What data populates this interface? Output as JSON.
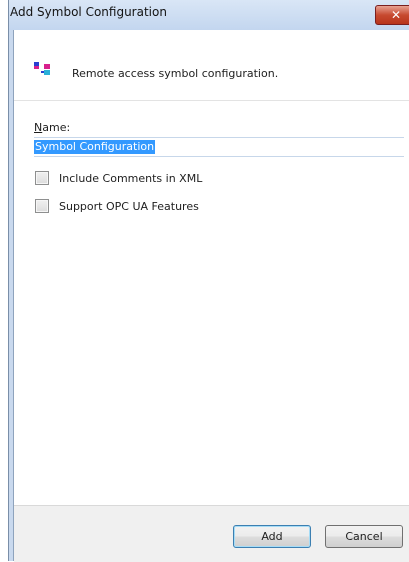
{
  "window": {
    "title": "Add Symbol Configuration",
    "close_glyph": "✕"
  },
  "header": {
    "icon": "symbol-configuration-icon",
    "text": "Remote access symbol configuration."
  },
  "form": {
    "name_label": "Name:",
    "name_value": "Symbol Configuration",
    "checkboxes": [
      {
        "label": "Include Comments in XML",
        "checked": false
      },
      {
        "label": "Support OPC UA Features",
        "checked": false
      }
    ]
  },
  "footer": {
    "add_label": "Add",
    "cancel_label": "Cancel"
  },
  "colors": {
    "titlebar": "#c9d9ee",
    "selection": "#3399ff",
    "close_button": "#c74a30"
  }
}
